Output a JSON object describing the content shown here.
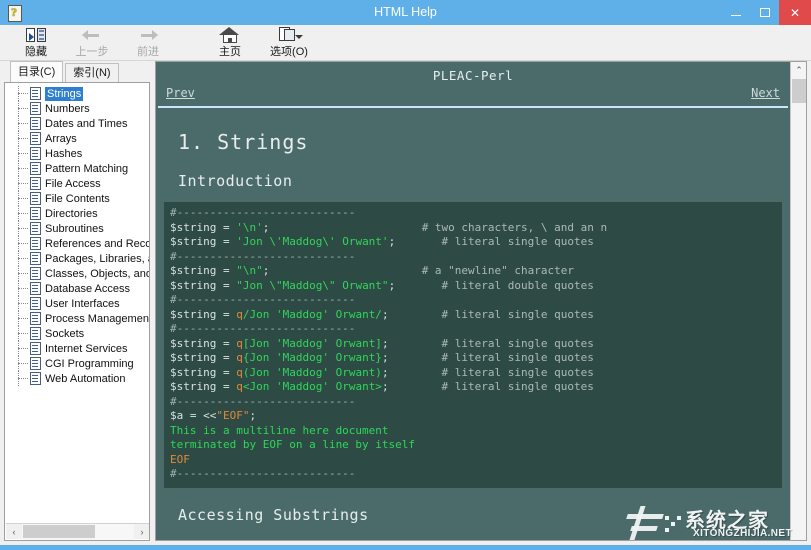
{
  "window": {
    "title": "HTML Help",
    "icon_name": "html-help-icon",
    "controls": {
      "minimize": "–",
      "maximize": "❐",
      "close": "✕"
    }
  },
  "toolbar": {
    "buttons": [
      {
        "label": "隐藏",
        "icon": "hide-panel-icon",
        "disabled": false
      },
      {
        "label": "上一步",
        "icon": "back-arrow-icon",
        "disabled": true
      },
      {
        "label": "前进",
        "icon": "forward-arrow-icon",
        "disabled": true
      },
      {
        "label": "主页",
        "icon": "home-icon",
        "disabled": false
      },
      {
        "label": "选项(O)",
        "icon": "options-icon",
        "disabled": false
      }
    ]
  },
  "sidebar": {
    "tabs": [
      {
        "label": "目录(C)",
        "active": true
      },
      {
        "label": "索引(N)",
        "active": false
      }
    ],
    "tree_items": [
      {
        "label": "Strings",
        "selected": true
      },
      {
        "label": "Numbers",
        "selected": false
      },
      {
        "label": "Dates and Times",
        "selected": false
      },
      {
        "label": "Arrays",
        "selected": false
      },
      {
        "label": "Hashes",
        "selected": false
      },
      {
        "label": "Pattern Matching",
        "selected": false
      },
      {
        "label": "File Access",
        "selected": false
      },
      {
        "label": "File Contents",
        "selected": false
      },
      {
        "label": "Directories",
        "selected": false
      },
      {
        "label": "Subroutines",
        "selected": false
      },
      {
        "label": "References and Reco",
        "selected": false
      },
      {
        "label": "Packages, Libraries, a",
        "selected": false
      },
      {
        "label": "Classes, Objects, and",
        "selected": false
      },
      {
        "label": "Database Access",
        "selected": false
      },
      {
        "label": "User Interfaces",
        "selected": false
      },
      {
        "label": "Process Management",
        "selected": false
      },
      {
        "label": "Sockets",
        "selected": false
      },
      {
        "label": "Internet Services",
        "selected": false
      },
      {
        "label": "CGI Programming",
        "selected": false
      },
      {
        "label": "Web Automation",
        "selected": false
      }
    ],
    "hscroll": {
      "left_arrow": "‹",
      "right_arrow": "›"
    }
  },
  "document": {
    "header_title": "PLEAC-Perl",
    "prev_link": "Prev",
    "next_link": "Next",
    "heading1": "1.  Strings",
    "heading2": "Introduction",
    "heading3": "Accessing Substrings",
    "code_lines": [
      [
        {
          "t": "#---------------------------",
          "c": "sep"
        }
      ],
      [
        {
          "t": "$string",
          "c": "var"
        },
        {
          "t": " = ",
          "c": "op"
        },
        {
          "t": "'\\n'",
          "c": "str"
        },
        {
          "t": ";",
          "c": "op"
        },
        {
          "t": "                       ",
          "c": "op"
        },
        {
          "t": "# two characters, \\ and an n",
          "c": "cmt"
        }
      ],
      [
        {
          "t": "$string",
          "c": "var"
        },
        {
          "t": " = ",
          "c": "op"
        },
        {
          "t": "'Jon \\'Maddog\\' Orwant'",
          "c": "str"
        },
        {
          "t": ";",
          "c": "op"
        },
        {
          "t": "       ",
          "c": "op"
        },
        {
          "t": "# literal single quotes",
          "c": "cmt"
        }
      ],
      [
        {
          "t": "#---------------------------",
          "c": "sep"
        }
      ],
      [
        {
          "t": "$string",
          "c": "var"
        },
        {
          "t": " = ",
          "c": "op"
        },
        {
          "t": "\"\\n\"",
          "c": "str"
        },
        {
          "t": ";",
          "c": "op"
        },
        {
          "t": "                       ",
          "c": "op"
        },
        {
          "t": "# a \"newline\" character",
          "c": "cmt"
        }
      ],
      [
        {
          "t": "$string",
          "c": "var"
        },
        {
          "t": " = ",
          "c": "op"
        },
        {
          "t": "\"Jon \\\"Maddog\\\" Orwant\"",
          "c": "str"
        },
        {
          "t": ";",
          "c": "op"
        },
        {
          "t": "       ",
          "c": "op"
        },
        {
          "t": "# literal double quotes",
          "c": "cmt"
        }
      ],
      [
        {
          "t": "#---------------------------",
          "c": "sep"
        }
      ],
      [
        {
          "t": "$string",
          "c": "var"
        },
        {
          "t": " = ",
          "c": "op"
        },
        {
          "t": "q",
          "c": "qop"
        },
        {
          "t": "/Jon 'Maddog' Orwant/",
          "c": "str"
        },
        {
          "t": ";",
          "c": "op"
        },
        {
          "t": "        ",
          "c": "op"
        },
        {
          "t": "# literal single quotes",
          "c": "cmt"
        }
      ],
      [
        {
          "t": "#---------------------------",
          "c": "sep"
        }
      ],
      [
        {
          "t": "$string",
          "c": "var"
        },
        {
          "t": " = ",
          "c": "op"
        },
        {
          "t": "q",
          "c": "qop"
        },
        {
          "t": "[Jon 'Maddog' Orwant]",
          "c": "str"
        },
        {
          "t": ";",
          "c": "op"
        },
        {
          "t": "        ",
          "c": "op"
        },
        {
          "t": "# literal single quotes",
          "c": "cmt"
        }
      ],
      [
        {
          "t": "$string",
          "c": "var"
        },
        {
          "t": " = ",
          "c": "op"
        },
        {
          "t": "q",
          "c": "qop"
        },
        {
          "t": "{Jon 'Maddog' Orwant}",
          "c": "str"
        },
        {
          "t": ";",
          "c": "op"
        },
        {
          "t": "        ",
          "c": "op"
        },
        {
          "t": "# literal single quotes",
          "c": "cmt"
        }
      ],
      [
        {
          "t": "$string",
          "c": "var"
        },
        {
          "t": " = ",
          "c": "op"
        },
        {
          "t": "q",
          "c": "qop"
        },
        {
          "t": "(Jon 'Maddog' Orwant)",
          "c": "str"
        },
        {
          "t": ";",
          "c": "op"
        },
        {
          "t": "        ",
          "c": "op"
        },
        {
          "t": "# literal single quotes",
          "c": "cmt"
        }
      ],
      [
        {
          "t": "$string",
          "c": "var"
        },
        {
          "t": " = ",
          "c": "op"
        },
        {
          "t": "q",
          "c": "qop"
        },
        {
          "t": "<Jon 'Maddog' Orwant>",
          "c": "str"
        },
        {
          "t": ";",
          "c": "op"
        },
        {
          "t": "        ",
          "c": "op"
        },
        {
          "t": "# literal single quotes",
          "c": "cmt"
        }
      ],
      [
        {
          "t": "#---------------------------",
          "c": "sep"
        }
      ],
      [
        {
          "t": "$a",
          "c": "var"
        },
        {
          "t": " = ",
          "c": "op"
        },
        {
          "t": "<<",
          "c": "op"
        },
        {
          "t": "\"EOF\"",
          "c": "hdoc"
        },
        {
          "t": ";",
          "c": "op"
        }
      ],
      [
        {
          "t": "This is a multiline here document",
          "c": "str"
        }
      ],
      [
        {
          "t": "terminated by EOF on a line by itself",
          "c": "str"
        }
      ],
      [
        {
          "t": "EOF",
          "c": "hdoc"
        }
      ],
      [
        {
          "t": "#---------------------------",
          "c": "sep"
        }
      ]
    ],
    "vscroll": {
      "up_arrow": "⌃",
      "down_arrow": "⌄"
    }
  },
  "watermark": {
    "chinese": "系统之家",
    "english": "XITONGZHIJIA.NET"
  },
  "colors": {
    "titlebar": "#5fb0e8",
    "close_button": "#e04a4a",
    "doc_background": "#4b6b6b",
    "code_background": "#2e4a44",
    "string_green": "#2fd65a",
    "q_operator_orange": "#e08a3c",
    "comment_gray": "#aab9b9",
    "selection_blue": "#2f7fd1"
  }
}
